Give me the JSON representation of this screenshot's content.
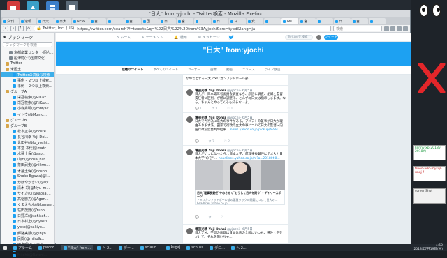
{
  "window": {
    "title": "\"日大\" from:yjochi - Twitter検索 - Mozilla Firefox",
    "url": "https://twitter.com/search?f=tweets&q=%22日大%22%20from%3Ayjochi&src=typd&lang=ja",
    "url_host": "Twitter, Inc. (US)",
    "search_placeholder": "検索"
  },
  "tabs": [
    "夕刊...",
    "速報...",
    "日大...",
    "日大...",
    "NEW...",
    "宮...",
    "ニ...",
    "宮...",
    "国...",
    "日...",
    "宮...",
    "ニ...",
    "日...",
    "ヨ...",
    "女...",
    "ニ...",
    "Twi...",
    "宮...",
    "ニ...",
    "日...",
    "宮...",
    "ニ..."
  ],
  "sidebar": {
    "title": "ブックマーク",
    "search_placeholder": "ブックマークを検索",
    "items": [
      {
        "label": "京都産業センター-個人...",
        "indent": 2,
        "icon": "page"
      },
      {
        "label": "船津町(ﾅﾝ)国際文化...",
        "indent": 2,
        "icon": "page"
      },
      {
        "label": "Twitter",
        "indent": 1,
        "icon": "folder"
      },
      {
        "label": "米国土",
        "indent": 1,
        "icon": "folder"
      },
      {
        "label": "Twitterの高級な検索",
        "indent": 3,
        "icon": "twitter",
        "selected": true
      },
      {
        "label": "事例 - ２つ以上検索...",
        "indent": 3,
        "icon": "twitter"
      },
      {
        "label": "事例 - ２つ以上検索...",
        "indent": 3,
        "icon": "twitter"
      },
      {
        "label": "グループA",
        "indent": 1,
        "icon": "folder"
      },
      {
        "label": "栄冠検索(@RiKaz...",
        "indent": 3,
        "icon": "twitter"
      },
      {
        "label": "栄冠検索(@RiKaz...",
        "indent": 3,
        "icon": "twitter"
      },
      {
        "label": "小森秀明(@mbt/ak...",
        "indent": 3,
        "icon": "twitter"
      },
      {
        "label": "イトウ(@Momo...",
        "indent": 3,
        "icon": "twitter"
      },
      {
        "label": "グループB",
        "indent": 1,
        "icon": "folder"
      },
      {
        "label": "グループB",
        "indent": 1,
        "icon": "folder"
      },
      {
        "label": "松本正章(@hoste...",
        "indent": 3,
        "icon": "twitter"
      },
      {
        "label": "長谷川幸 Yoji Doi...",
        "indent": 3,
        "icon": "twitter"
      },
      {
        "label": "世田谷(@lo_yoshi...",
        "indent": 3,
        "icon": "twitter"
      },
      {
        "label": "本堂 ネ代(@matc...",
        "indent": 3,
        "icon": "twitter"
      },
      {
        "label": "水蓮土保(@aso...",
        "indent": 3,
        "icon": "twitter"
      },
      {
        "label": "山田(@hosa_niin...",
        "indent": 3,
        "icon": "twitter"
      },
      {
        "label": "茶田武史(@nikrm...",
        "indent": 3,
        "icon": "twitter"
      },
      {
        "label": "木蓮土保(@nosho...",
        "indent": 3,
        "icon": "twitter"
      },
      {
        "label": "Shoko Egawa(@l...",
        "indent": 3,
        "icon": "twitter"
      },
      {
        "label": "かばやかきい(@aiy...",
        "indent": 3,
        "icon": "twitter"
      },
      {
        "label": "清木 彩(@Myu_m...",
        "indent": 3,
        "icon": "twitter"
      },
      {
        "label": "サイカの(@kaosai...",
        "indent": 3,
        "icon": "twitter"
      },
      {
        "label": "高稲勝力(@Agon...",
        "indent": 3,
        "icon": "twitter"
      },
      {
        "label": "くまえもん(@kumae...",
        "indent": 3,
        "icon": "twitter"
      },
      {
        "label": "荘田茂野(@Yuno...",
        "indent": 3,
        "icon": "twitter"
      },
      {
        "label": "日野洋(@sakisak...",
        "indent": 3,
        "icon": "twitter"
      },
      {
        "label": "日本村上(@nyasti...",
        "indent": 3,
        "icon": "twitter"
      },
      {
        "label": "yoko(@kakiyo...",
        "indent": 3,
        "icon": "twitter"
      },
      {
        "label": "郵路実期(@ginyo...",
        "indent": 3,
        "icon": "twitter"
      },
      {
        "label": "民間(@miho&...",
        "indent": 3,
        "icon": "twitter"
      },
      {
        "label": "田家昭(ヘンテュ...",
        "indent": 3,
        "icon": "twitter"
      },
      {
        "label": "山本昭(@Fujina...",
        "indent": 3,
        "icon": "twitter"
      },
      {
        "label": "Mitchi(@Ratchi...",
        "indent": 3,
        "icon": "twitter"
      }
    ]
  },
  "twitter": {
    "nav": [
      "ホーム",
      "モーメント",
      "通知",
      "メッセージ"
    ],
    "search_placeholder": "Twitterを検索",
    "tweet_button": "ツイート",
    "search_title": "\"日大\" from:yjochi",
    "tabs": [
      "話題のツイート",
      "すべてのツイート",
      "ユーザー",
      "画像",
      "動画",
      "ニュース",
      "ライブ放送"
    ],
    "tweets": [
      {
        "name": "告訴・告発する人たちのため 第三者委員会",
        "handle": "",
        "body": "なのでとする日大アメリカンフットボール部...",
        "actions": [
          "",
          "",
          ""
        ]
      },
      {
        "name": "増田光晴 Yoji Dohsi",
        "handle": "@yjochi · 6月5日",
        "body": "日大が、日本第三者委員会調査なら、原因に調査、組織と監督責任者に区別、が極に調整で、とんずね日大は指示しまます。なら。ちゃんとやってくるも知らないよ。",
        "actions": [
          "1",
          "1",
          "1"
        ]
      },
      {
        "name": "増田光晴 Yoji Dohsi",
        "handle": "@yjochi · 6月5日",
        "body": "日大で判行為に来大の事件がある。アメフトの監事が日大が理由あります法。田家で行政の立大の事について日大の監督・内田行政前監督判の結果...",
        "link": "news.yahoo.co.jp/pickup/6284...",
        "actions": [
          "",
          "2",
          "2"
        ]
      },
      {
        "name": "増田光晴 Yoji Dohsi",
        "handle": "@yjochi · 6月5日",
        "body": "日大がいつになったら…日本大学、前理事長兼任にアメ大と日本大学\"のを\" ...",
        "link": "headlines.yahoo.co.jp/hl?a=2018060...",
        "actions": [
          "",
          "",
          ""
        ],
        "card_title": "日大\"理事長兼任\"やめさせて\"どうして日大を問う\" - デイリースポーツ",
        "card_desc": "アメリカンフットボール部の悪質タックル問題について日大の…",
        "card_host": "headlines.yahoo.co.jp"
      },
      {
        "name": "増田光晴 Yoji Dohsi",
        "handle": "@yjochi · 6月5日",
        "body": "日大アメ、学問の真意は日本体育の全部にいつも、選外と学をかけて、それを聞いちゃ...",
        "actions": [
          "",
          "",
          ""
        ]
      }
    ]
  },
  "taskbar": {
    "tasks": [
      "アラーム",
      "pworz...",
      "\"日大\" from...",
      "ヘ-2...",
      "デー...",
      "sclaud...",
      "kugaj",
      "schuss",
      "デロ...",
      "ヘ-2..."
    ],
    "time": "4:50",
    "date": "2018年7月19日(木)"
  },
  "rightpanel": {
    "box1": "kenny-xp(2018v-2018Y)",
    "box2": "freed-add-mysql-unqj-f",
    "box3": "screenShot"
  }
}
